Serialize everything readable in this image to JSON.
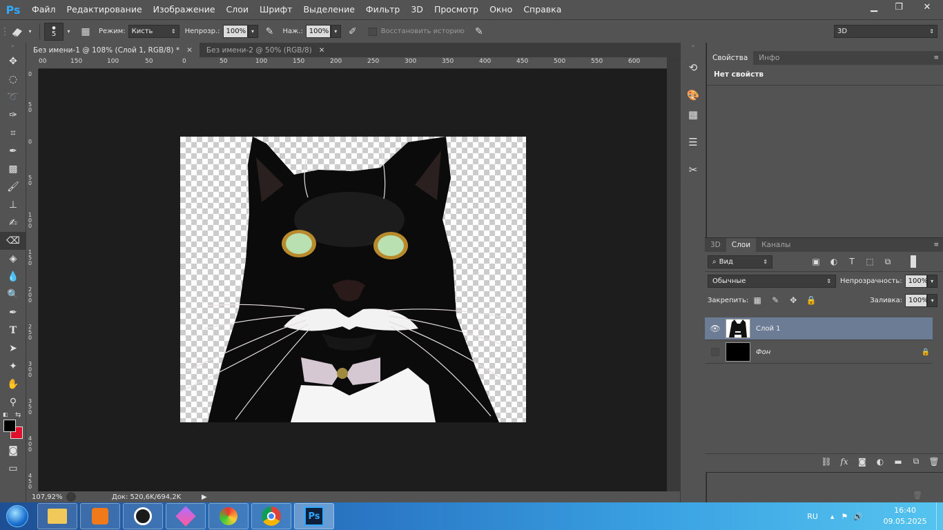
{
  "app": {
    "logo": "Ps"
  },
  "menu": [
    "Файл",
    "Редактирование",
    "Изображение",
    "Слои",
    "Шрифт",
    "Выделение",
    "Фильтр",
    "3D",
    "Просмотр",
    "Окно",
    "Справка"
  ],
  "window_controls": {
    "minimize": "▁",
    "restore": "❐",
    "close": "✕"
  },
  "options": {
    "brush_size": "5",
    "mode_label": "Режим:",
    "mode_value": "Кисть",
    "opacity_label": "Непрозр.:",
    "opacity_value": "100%",
    "pressure_label": "Наж.:",
    "pressure_value": "100%",
    "restore_history": "Восстановить историю",
    "workspace": "3D"
  },
  "tabs": [
    {
      "label": "Без имени-1 @ 108% (Слой 1, RGB/8) *",
      "active": true
    },
    {
      "label": "Без имени-2 @ 50% (RGB/8)",
      "active": false
    }
  ],
  "ruler_h": [
    "00",
    "150",
    "100",
    "50",
    "0",
    "50",
    "100",
    "150",
    "200",
    "250",
    "300",
    "350",
    "400",
    "450",
    "500",
    "550",
    "600",
    "650"
  ],
  "ruler_v": [
    "0",
    "50",
    "0",
    "50",
    "100",
    "150",
    "200",
    "250",
    "300",
    "350",
    "400",
    "450"
  ],
  "status": {
    "zoom": "107,92%",
    "doc": "Док: 520,6K/694,2K"
  },
  "properties": {
    "tabs": [
      "Свойства",
      "Инфо"
    ],
    "message": "Нет свойств"
  },
  "layers_panel": {
    "tabs": [
      "3D",
      "Слои",
      "Каналы"
    ],
    "filter": "Вид",
    "blend": "Обычные",
    "opacity_label": "Непрозрачность:",
    "opacity_value": "100%",
    "lock_label": "Закрепить:",
    "fill_label": "Заливка:",
    "fill_value": "100%",
    "layers": [
      {
        "name": "Слой 1",
        "selected": true,
        "visible": true
      },
      {
        "name": "Фон",
        "selected": false,
        "visible": false,
        "locked": true
      }
    ]
  },
  "taskbar": {
    "lang": "RU",
    "time": "16:40",
    "date": "09.05.2025",
    "apps": [
      "explorer",
      "media-player",
      "speedometer",
      "gem-app",
      "color-app",
      "chrome",
      "photoshop"
    ]
  }
}
